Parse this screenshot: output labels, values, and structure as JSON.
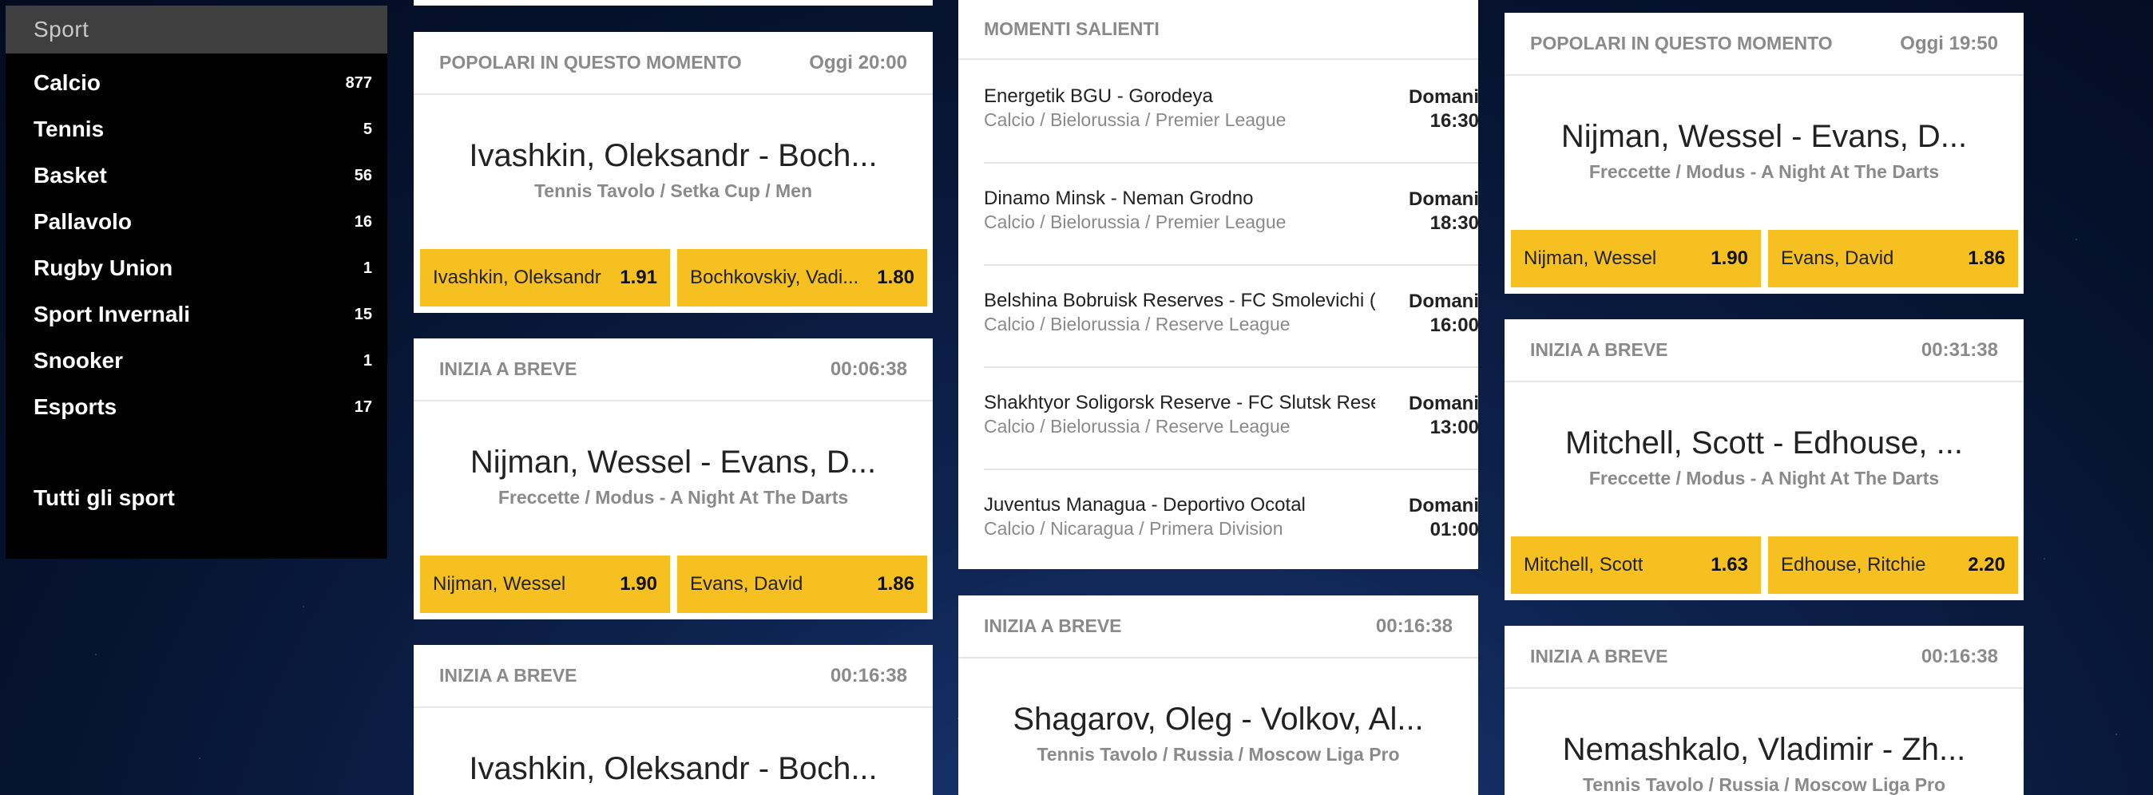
{
  "sidebar": {
    "header": "Sport",
    "items": [
      {
        "label": "Calcio",
        "count": "877"
      },
      {
        "label": "Tennis",
        "count": "5"
      },
      {
        "label": "Basket",
        "count": "56"
      },
      {
        "label": "Pallavolo",
        "count": "16"
      },
      {
        "label": "Rugby Union",
        "count": "1"
      },
      {
        "label": "Sport Invernali",
        "count": "15"
      },
      {
        "label": "Snooker",
        "count": "1"
      },
      {
        "label": "Esports",
        "count": "17"
      }
    ],
    "all_sports": "Tutti gli sport"
  },
  "col1": {
    "card1": {
      "title": "POPOLARI IN QUESTO MOMENTO",
      "time": "Oggi 20:00",
      "match": "Ivashkin, Oleksandr - Boch...",
      "path": "Tennis Tavolo  /  Setka Cup  /  Men",
      "odd1_name": "Ivashkin, Oleksandr",
      "odd1_val": "1.91",
      "odd2_name": "Bochkovskiy, Vadi...",
      "odd2_val": "1.80"
    },
    "card2": {
      "title": "INIZIA A BREVE",
      "time": "00:06:38",
      "match": "Nijman, Wessel - Evans, D...",
      "path": "Freccette  /  Modus - A Night At The Darts",
      "odd1_name": "Nijman, Wessel",
      "odd1_val": "1.90",
      "odd2_name": "Evans, David",
      "odd2_val": "1.86"
    },
    "card3": {
      "title": "INIZIA A BREVE",
      "time": "00:16:38",
      "match": "Ivashkin, Oleksandr - Boch..."
    }
  },
  "col2": {
    "highlights": {
      "title": "MOMENTI SALIENTI",
      "rows": [
        {
          "name": "Energetik BGU - Gorodeya",
          "path": "Calcio  /  Bielorussia  /  Premier League",
          "day": "Domani",
          "time": "16:30"
        },
        {
          "name": "Dinamo Minsk - Neman Grodno",
          "path": "Calcio  /  Bielorussia  /  Premier League",
          "day": "Domani",
          "time": "18:30"
        },
        {
          "name": "Belshina Bobruisk Reserves - FC Smolevichi (...",
          "path": "Calcio  /  Bielorussia  /  Reserve League",
          "day": "Domani",
          "time": "16:00"
        },
        {
          "name": "Shakhtyor Soligorsk Reserve - FC Slutsk Rese...",
          "path": "Calcio  /  Bielorussia  /  Reserve League",
          "day": "Domani",
          "time": "13:00"
        },
        {
          "name": "Juventus Managua - Deportivo Ocotal",
          "path": "Calcio  /  Nicaragua  /  Primera Division",
          "day": "Domani",
          "time": "01:00"
        }
      ]
    },
    "card": {
      "title": "INIZIA A BREVE",
      "time": "00:16:38",
      "match": "Shagarov, Oleg - Volkov, Al...",
      "path": "Tennis Tavolo  /  Russia  /  Moscow Liga Pro"
    }
  },
  "col3": {
    "card1": {
      "title": "POPOLARI IN QUESTO MOMENTO",
      "time": "Oggi 19:50",
      "match": "Nijman, Wessel - Evans, D...",
      "path": "Freccette  /  Modus - A Night At The Darts",
      "odd1_name": "Nijman, Wessel",
      "odd1_val": "1.90",
      "odd2_name": "Evans, David",
      "odd2_val": "1.86"
    },
    "card2": {
      "title": "INIZIA A BREVE",
      "time": "00:31:38",
      "match": "Mitchell, Scott - Edhouse, ...",
      "path": "Freccette  /  Modus - A Night At The Darts",
      "odd1_name": "Mitchell, Scott",
      "odd1_val": "1.63",
      "odd2_name": "Edhouse, Ritchie",
      "odd2_val": "2.20"
    },
    "card3": {
      "title": "INIZIA A BREVE",
      "time": "00:16:38",
      "match": "Nemashkalo, Vladimir - Zh...",
      "path": "Tennis Tavolo  /  Russia  /  Moscow Liga Pro"
    }
  }
}
